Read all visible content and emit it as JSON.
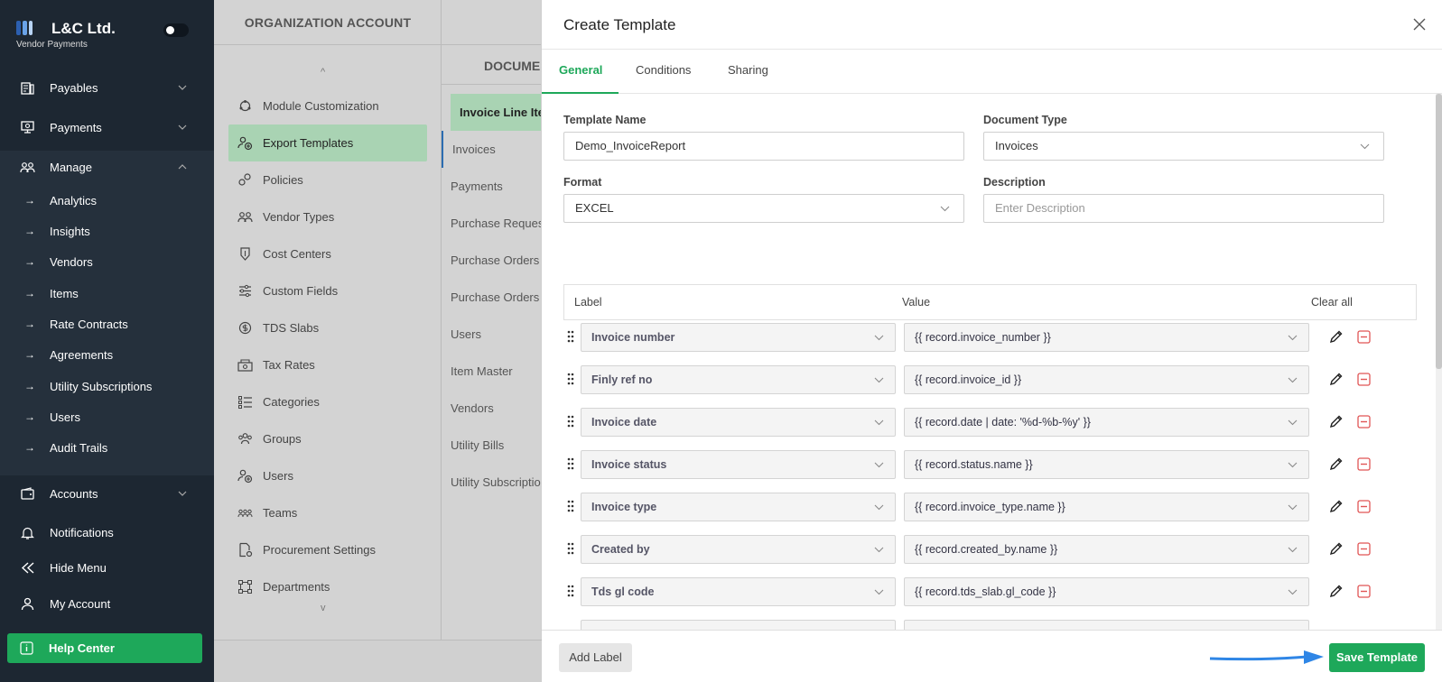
{
  "brand": {
    "name": "L&C Ltd.",
    "subtitle": "Vendor Payments"
  },
  "sidebar": {
    "items": [
      {
        "label": "Payables",
        "icon": "payables-icon"
      },
      {
        "label": "Payments",
        "icon": "payments-icon"
      },
      {
        "label": "Manage",
        "icon": "manage-icon"
      }
    ],
    "manage_sub": [
      {
        "label": "Analytics"
      },
      {
        "label": "Insights"
      },
      {
        "label": "Vendors"
      },
      {
        "label": "Items"
      },
      {
        "label": "Rate Contracts"
      },
      {
        "label": "Agreements"
      },
      {
        "label": "Utility Subscriptions"
      },
      {
        "label": "Users"
      },
      {
        "label": "Audit Trails"
      }
    ],
    "bottom_items": [
      {
        "label": "Accounts",
        "icon": "accounts-icon"
      },
      {
        "label": "Notifications",
        "icon": "bell-icon"
      },
      {
        "label": "Hide Menu",
        "icon": "double-chevron-left-icon"
      },
      {
        "label": "My Account",
        "icon": "user-icon"
      }
    ],
    "help": "Help Center",
    "arrow_glyph": "→"
  },
  "org": {
    "title": "ORGANIZATION ACCOUNT",
    "caret_up": "^",
    "caret_down": "v",
    "items": [
      {
        "label": "Module Customization"
      },
      {
        "label": "Export Templates"
      },
      {
        "label": "Policies"
      },
      {
        "label": "Vendor Types"
      },
      {
        "label": "Cost Centers"
      },
      {
        "label": "Custom Fields"
      },
      {
        "label": "TDS Slabs"
      },
      {
        "label": "Tax Rates"
      },
      {
        "label": "Categories"
      },
      {
        "label": "Groups"
      },
      {
        "label": "Users"
      },
      {
        "label": "Teams"
      },
      {
        "label": "Procurement Settings"
      },
      {
        "label": "Departments"
      }
    ]
  },
  "documents": {
    "title": "DOCUMENTS",
    "items": [
      {
        "label": "Invoice Line Items"
      },
      {
        "label": "Invoices"
      },
      {
        "label": "Payments"
      },
      {
        "label": "Purchase Requests"
      },
      {
        "label": "Purchase Orders"
      },
      {
        "label": "Purchase Orders"
      },
      {
        "label": "Users"
      },
      {
        "label": "Item Master"
      },
      {
        "label": "Vendors"
      },
      {
        "label": "Utility Bills"
      },
      {
        "label": "Utility Subscriptions"
      }
    ]
  },
  "modal": {
    "title": "Create Template",
    "tabs": [
      {
        "label": "General"
      },
      {
        "label": "Conditions"
      },
      {
        "label": "Sharing"
      }
    ],
    "form": {
      "template_name_label": "Template Name",
      "template_name_value": "Demo_InvoiceReport",
      "document_type_label": "Document Type",
      "document_type_value": "Invoices",
      "format_label": "Format",
      "format_value": "EXCEL",
      "description_label": "Description",
      "description_placeholder": "Enter Description"
    },
    "table": {
      "col_label": "Label",
      "col_value": "Value",
      "clear_all": "Clear all",
      "rows": [
        {
          "label": "Invoice number",
          "value": "{{ record.invoice_number }}"
        },
        {
          "label": "Finly ref no",
          "value": "{{ record.invoice_id }}"
        },
        {
          "label": "Invoice date",
          "value": "{{ record.date | date: '%d-%b-%y' }}"
        },
        {
          "label": "Invoice status",
          "value": "{{ record.status.name }}"
        },
        {
          "label": "Invoice type",
          "value": "{{ record.invoice_type.name }}"
        },
        {
          "label": "Created by",
          "value": "{{ record.created_by.name }}"
        },
        {
          "label": "Tds gl code",
          "value": "{{ record.tds_slab.gl_code }}"
        }
      ]
    },
    "add_label": "Add Label",
    "save_template": "Save Template"
  },
  "colors": {
    "accent": "#1ea85a",
    "sidebar": "#1d2732",
    "arrow": "#2f86e6"
  }
}
